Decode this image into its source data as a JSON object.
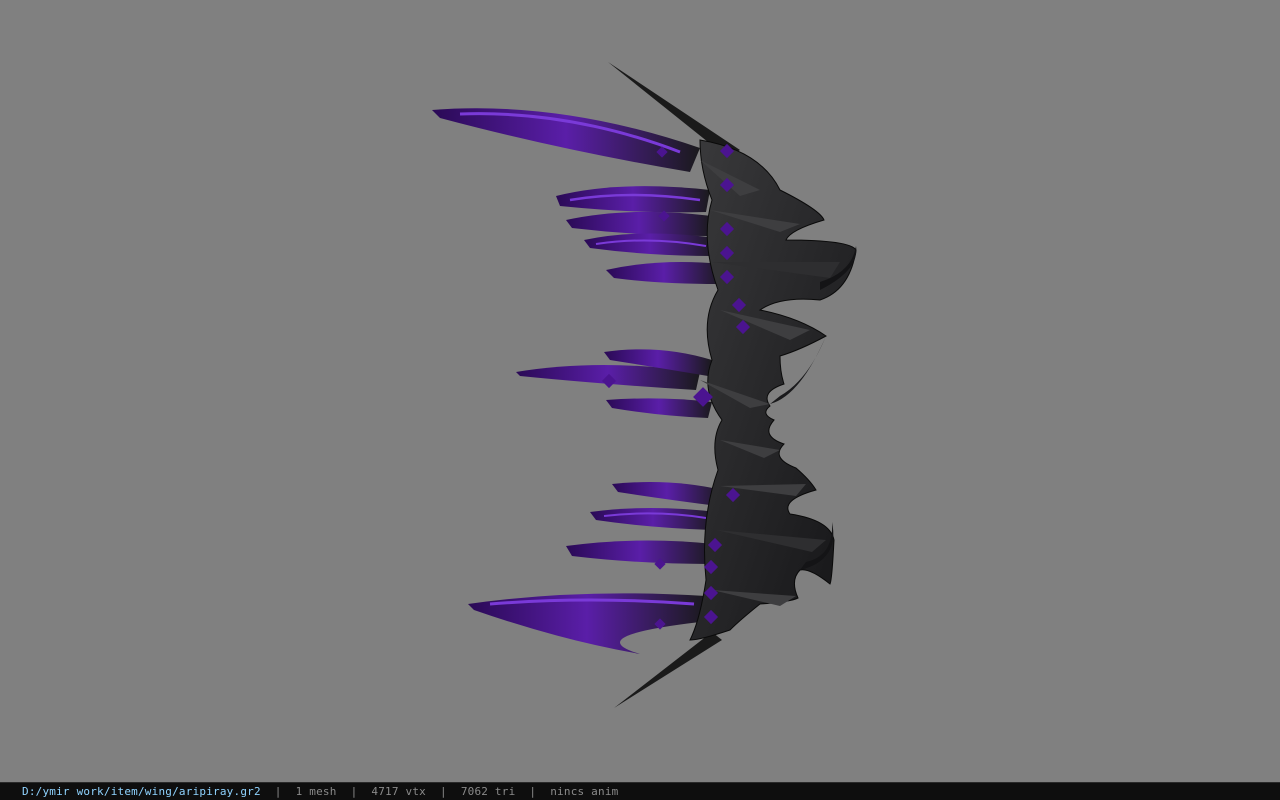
{
  "status_bar": {
    "file_path": "D:/ymir work/item/wing/aripiray.gr2",
    "separator": "|",
    "mesh_count": "1 mesh",
    "vertex_count": "4717 vtx",
    "triangle_count": "7062 tri",
    "animation": "nincs anim"
  },
  "viewport": {
    "background_color": "#808080",
    "model_name": "wing-model",
    "model_colors": {
      "armor_dark": "#1c1c1e",
      "armor_mid": "#2e2e30",
      "armor_edge": "#4a4a4c",
      "feather_purple": "#5a1ea8",
      "feather_glow": "#7a3ad8",
      "gem_purple": "#4b1490"
    }
  }
}
